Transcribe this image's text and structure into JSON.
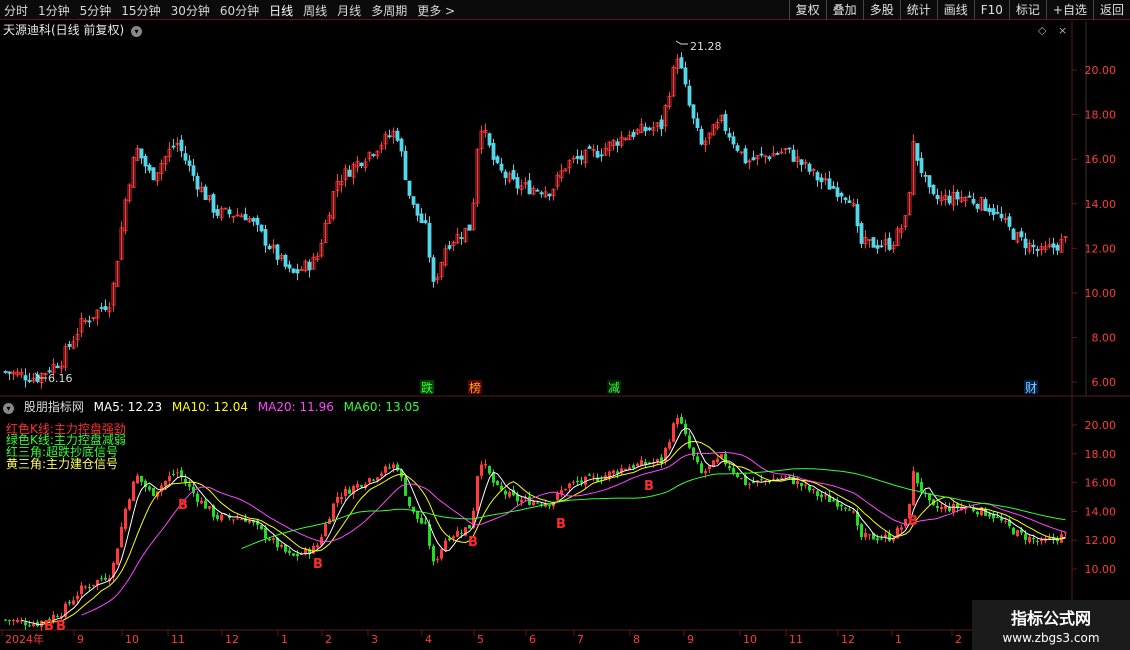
{
  "toolbar": {
    "periods": [
      "分时",
      "1分钟",
      "5分钟",
      "15分钟",
      "30分钟",
      "60分钟",
      "日线",
      "周线",
      "月线",
      "多周期",
      "更多 >"
    ],
    "active_period": "日线",
    "tools": [
      "复权",
      "叠加",
      "多股",
      "统计",
      "画线",
      "F10",
      "标记",
      "+自选",
      "返回"
    ]
  },
  "main_chart": {
    "title": "天源迪科(日线 前复权)",
    "high_label": "21.28",
    "low_label": "6.16",
    "y_ticks": [
      "20.00",
      "18.00",
      "16.00",
      "14.00",
      "12.00",
      "10.00",
      "8.00",
      "6.00"
    ],
    "event_markers": [
      "跌",
      "榜",
      "减",
      "财"
    ]
  },
  "sub_chart": {
    "name": "股朋指标网",
    "ma5": "MA5: 12.23",
    "ma10": "MA10: 12.04",
    "ma20": "MA20: 11.96",
    "ma60": "MA60: 13.05",
    "legend": [
      "红色K线:主力控盘强劲",
      "绿色K线:主力控盘减弱",
      "红三角:超跌抄底信号",
      "黄三角:主力建仓信号"
    ],
    "y_ticks": [
      "20.00",
      "18.00",
      "16.00",
      "14.00",
      "12.00",
      "10.00"
    ],
    "signal_label": "B"
  },
  "x_axis": {
    "labels": [
      "2024年",
      "9",
      "10",
      "11",
      "12",
      "1",
      "2",
      "3",
      "4",
      "5",
      "6",
      "7",
      "8",
      "9",
      "10",
      "11",
      "12",
      "1",
      "2"
    ]
  },
  "watermark": {
    "line1": "指标公式网",
    "line2": "www.zbgs3.com"
  },
  "colors": {
    "up": "#ff3b3b",
    "down": "#52d7e8",
    "sub_down": "#22dd22",
    "ma5": "#ffffff",
    "ma10": "#ffff00",
    "ma20": "#ff44ff",
    "ma60": "#33ff33",
    "grid": "#5a1a1a"
  }
}
